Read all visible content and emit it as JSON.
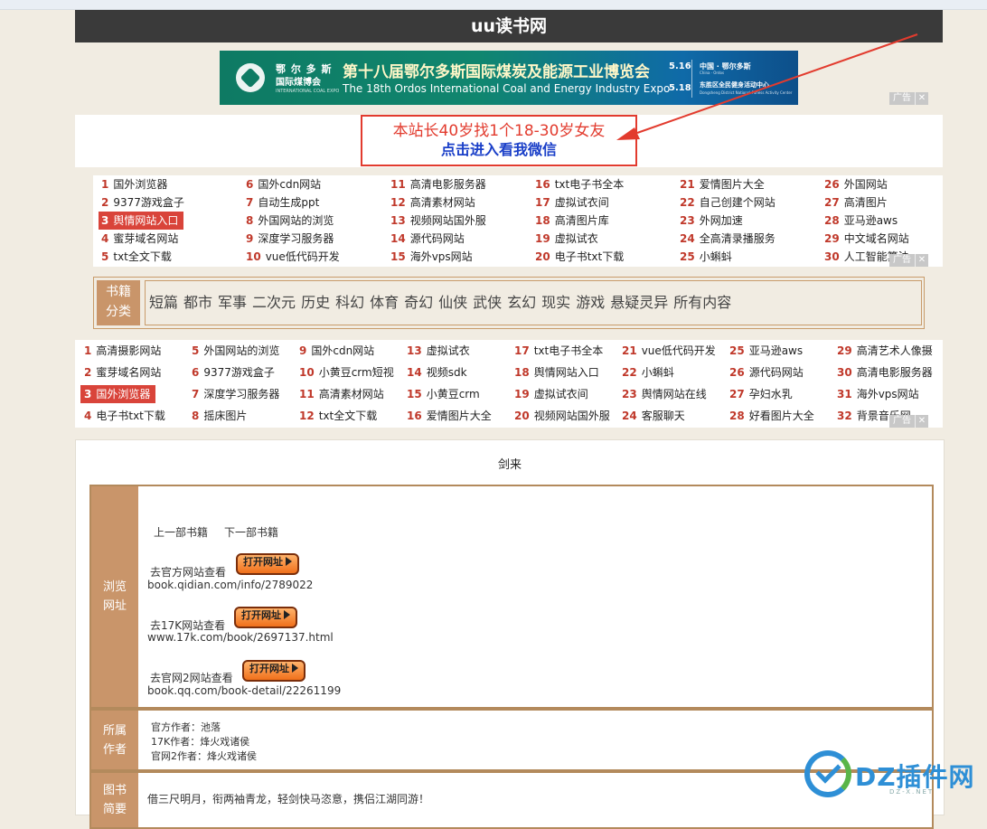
{
  "site": {
    "title": "uu读书网"
  },
  "banner": {
    "org_cn": "鄂 尔 多 斯",
    "org_cn2": "国际煤博会",
    "org_en": "INTERNATIONAL COAL EXPO",
    "title_cn": "第十八届鄂尔多斯国际煤炭及能源工业博览会",
    "title_en": "The 18th Ordos International Coal and Energy Industry Expo",
    "date_start": "5.16",
    "date_end": "5.18",
    "loc_cn": "中国 · 鄂尔多斯",
    "loc_en": "China · Ordos",
    "venue_cn": "东胜区全民健身活动中心",
    "venue_en": "Dongsheng District National Fitness Activity Center"
  },
  "ad_label": "广告",
  "ad_close": "✕",
  "promo": {
    "line1": "本站长40岁找1个18-30岁女友",
    "line2": "点击进入看我微信"
  },
  "grid1": {
    "columns": [
      [
        [
          "1",
          "国外浏览器"
        ],
        [
          "2",
          "9377游戏盒子"
        ],
        [
          "3",
          "舆情网站入口"
        ],
        [
          "4",
          "蜜芽域名网站"
        ],
        [
          "5",
          "txt全文下载"
        ]
      ],
      [
        [
          "6",
          "国外cdn网站"
        ],
        [
          "7",
          "自动生成ppt"
        ],
        [
          "8",
          "外国网站的浏览"
        ],
        [
          "9",
          "深度学习服务器"
        ],
        [
          "10",
          "vue低代码开发"
        ]
      ],
      [
        [
          "11",
          "高清电影服务器"
        ],
        [
          "12",
          "高清素材网站"
        ],
        [
          "13",
          "视频网站国外服"
        ],
        [
          "14",
          "源代码网站"
        ],
        [
          "15",
          "海外vps网站"
        ]
      ],
      [
        [
          "16",
          "txt电子书全本"
        ],
        [
          "17",
          "虚拟试衣间"
        ],
        [
          "18",
          "高清图片库"
        ],
        [
          "19",
          "虚拟试衣"
        ],
        [
          "20",
          "电子书txt下载"
        ]
      ],
      [
        [
          "21",
          "爱情图片大全"
        ],
        [
          "22",
          "自己创建个网站"
        ],
        [
          "23",
          "外网加速"
        ],
        [
          "24",
          "全高清录播服务"
        ],
        [
          "25",
          "小蝌蚪"
        ]
      ],
      [
        [
          "26",
          "外国网站"
        ],
        [
          "27",
          "高清图片"
        ],
        [
          "28",
          "亚马逊aws"
        ],
        [
          "29",
          "中文域名网站"
        ],
        [
          "30",
          "人工智能算法"
        ]
      ]
    ],
    "highlight": "3"
  },
  "categories": {
    "label": "书籍分类",
    "label_line1": "书籍",
    "label_line2": "分类",
    "items": [
      "短篇",
      "都市",
      "军事",
      "二次元",
      "历史",
      "科幻",
      "体育",
      "奇幻",
      "仙侠",
      "武侠",
      "玄幻",
      "现实",
      "游戏",
      "悬疑灵异",
      "所有内容"
    ]
  },
  "grid2": {
    "columns": [
      [
        [
          "1",
          "高清摄影网站"
        ],
        [
          "2",
          "蜜芽域名网站"
        ],
        [
          "3",
          "国外浏览器"
        ],
        [
          "4",
          "电子书txt下载"
        ]
      ],
      [
        [
          "5",
          "外国网站的浏览"
        ],
        [
          "6",
          "9377游戏盒子"
        ],
        [
          "7",
          "深度学习服务器"
        ],
        [
          "8",
          "摇床图片"
        ]
      ],
      [
        [
          "9",
          "国外cdn网站"
        ],
        [
          "10",
          "小黄豆crm短视"
        ],
        [
          "11",
          "高清素材网站"
        ],
        [
          "12",
          "txt全文下载"
        ]
      ],
      [
        [
          "13",
          "虚拟试衣"
        ],
        [
          "14",
          "视频sdk"
        ],
        [
          "15",
          "小黄豆crm"
        ],
        [
          "16",
          "爱情图片大全"
        ]
      ],
      [
        [
          "17",
          "txt电子书全本"
        ],
        [
          "18",
          "舆情网站入口"
        ],
        [
          "19",
          "虚拟试衣间"
        ],
        [
          "20",
          "视频网站国外服"
        ]
      ],
      [
        [
          "21",
          "vue低代码开发"
        ],
        [
          "22",
          "小蝌蚪"
        ],
        [
          "23",
          "舆情网站在线"
        ],
        [
          "24",
          "客服聊天"
        ]
      ],
      [
        [
          "25",
          "亚马逊aws"
        ],
        [
          "26",
          "源代码网站"
        ],
        [
          "27",
          "孕妇水乳"
        ],
        [
          "28",
          "好看图片大全"
        ]
      ],
      [
        [
          "29",
          "高清艺术人像摄"
        ],
        [
          "30",
          "高清电影服务器"
        ],
        [
          "31",
          "海外vps网站"
        ],
        [
          "32",
          "背景音乐网"
        ]
      ]
    ],
    "highlight": "3"
  },
  "book": {
    "name": "剑来",
    "browse_label_line1": "浏览",
    "browse_label_line2": "网址",
    "prev": "上一部书籍",
    "next": "下一部书籍",
    "open_btn": "打开网址",
    "sources": [
      {
        "label": "去官方网站查看",
        "url": "book.qidian.com/info/2789022"
      },
      {
        "label": "去17K网站查看",
        "url": "www.17k.com/book/2697137.html"
      },
      {
        "label": "去官网2网站查看",
        "url": "book.qq.com/book-detail/22261199"
      }
    ],
    "author_label_line1": "所属",
    "author_label_line2": "作者",
    "authors": [
      "官方作者：池落",
      "17K作者：烽火戏诸侯",
      "官网2作者：烽火戏诸侯"
    ],
    "intro_label_line1": "图书",
    "intro_label_line2": "简要",
    "intro": "借三尺明月，衔两袖青龙，轻剑快马恣意，携侣江湖同游！"
  },
  "watermark": {
    "text": "DZ插件网",
    "sub": "DZ-X.NET"
  },
  "colors": {
    "header": "#3a3a3a",
    "accent_red": "#d9443a",
    "link_blue": "#1a3fc8",
    "label_tan": "#c9956a"
  }
}
